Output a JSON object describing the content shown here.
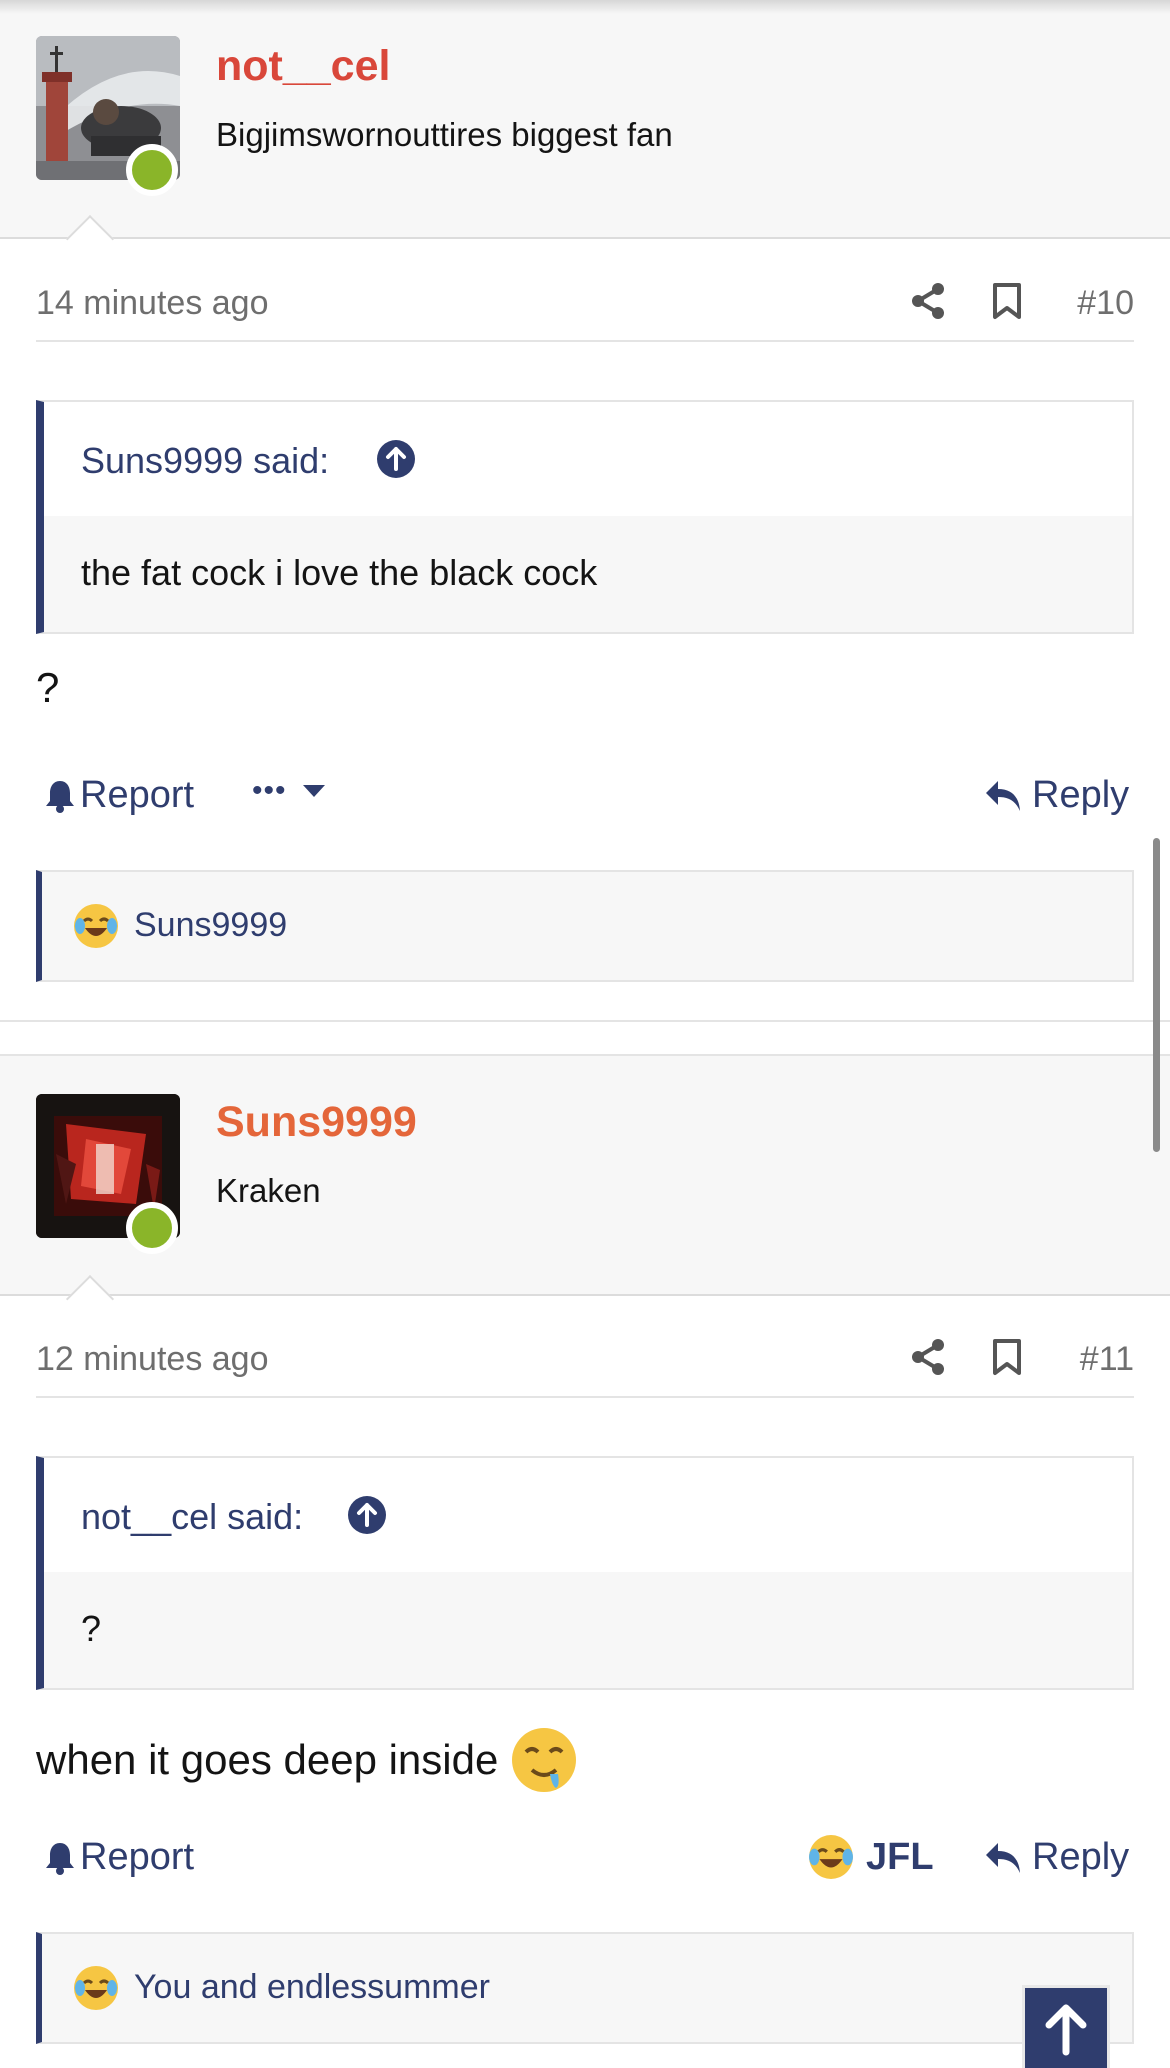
{
  "posts": [
    {
      "username": "not__cel",
      "username_color": "#d9473a",
      "user_title": "Bigjimswornouttires biggest fan",
      "time": "14 minutes ago",
      "post_number": "#10",
      "quote": {
        "attribution": "Suns9999 said:",
        "text": "the fat cock i love the black cock"
      },
      "body": "?",
      "actions": {
        "report": "Report",
        "more": "•••",
        "reply": "Reply"
      },
      "reactions": {
        "text": "Suns9999"
      }
    },
    {
      "username": "Suns9999",
      "username_color": "#e4663a",
      "user_title": "Kraken",
      "time": "12 minutes ago",
      "post_number": "#11",
      "quote": {
        "attribution": "not__cel said:",
        "text": "?"
      },
      "body": "when it goes deep inside",
      "actions": {
        "report": "Report",
        "reaction_label": "JFL",
        "reply": "Reply"
      },
      "reactions": {
        "text": "You and endlessummer"
      }
    }
  ],
  "icons": {
    "share": "share-icon",
    "bookmark": "bookmark-icon",
    "bell": "bell-icon",
    "reply": "reply-arrow-icon",
    "quote_up": "arrow-up-circle-icon",
    "scroll_top": "arrow-up-icon",
    "laugh": "laughing-crying-emoji",
    "drool": "drooling-emoji"
  },
  "colors": {
    "accent": "#2f3d6e",
    "online": "#8ab529"
  }
}
